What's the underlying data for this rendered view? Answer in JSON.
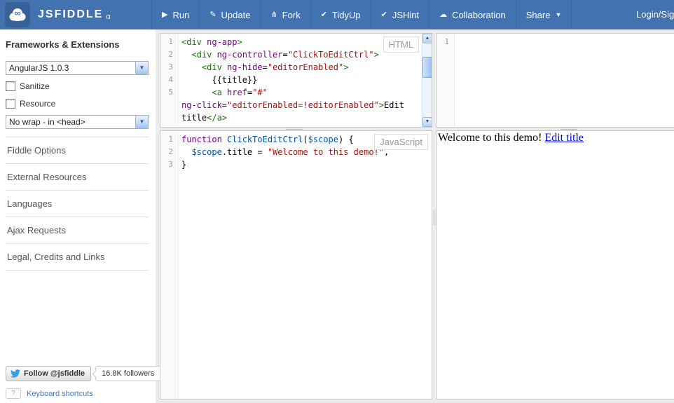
{
  "topbar": {
    "logo_text": "JSFIDDLE",
    "logo_badge": "α",
    "logo_infinity": "∞",
    "menu": [
      {
        "label": "Run",
        "icon": "play-icon",
        "glyph": "▶"
      },
      {
        "label": "Update",
        "icon": "pencil-icon",
        "glyph": "✎"
      },
      {
        "label": "Fork",
        "icon": "fork-icon",
        "glyph": "⋔"
      },
      {
        "label": "TidyUp",
        "icon": "check-icon",
        "glyph": "✔"
      },
      {
        "label": "JSHint",
        "icon": "check-icon",
        "glyph": "✔"
      },
      {
        "label": "Collaboration",
        "icon": "cloud-icon",
        "glyph": "☁"
      },
      {
        "label": "Share",
        "icon": "caret-down-icon",
        "glyph": "",
        "caret": "▼"
      }
    ],
    "login_label": "Login/Sig"
  },
  "sidebar": {
    "frameworks_heading": "Frameworks & Extensions",
    "framework_select_value": "AngularJS 1.0.3",
    "select_arrow": "▼",
    "checkboxes": [
      {
        "label": "Sanitize",
        "checked": false
      },
      {
        "label": "Resource",
        "checked": false
      }
    ],
    "wrap_select_value": "No wrap - in <head>",
    "sections": [
      "Fiddle Options",
      "External Resources",
      "Languages",
      "Ajax Requests",
      "Legal, Credits and Links"
    ],
    "follow_button_label": "Follow @jsfiddle",
    "followers_count": "16.8K followers",
    "shortcut_key": "?",
    "shortcuts_link": "Keyboard shortcuts"
  },
  "editors": {
    "html": {
      "label": "HTML",
      "scroll_up": "▲",
      "scroll_down": "▼",
      "lines": [
        {
          "n": "1",
          "segs": [
            {
              "t": "<div ",
              "c": "tag"
            },
            {
              "t": "ng-app",
              "c": "attr"
            },
            {
              "t": ">",
              "c": "tag"
            }
          ]
        },
        {
          "n": "2",
          "segs": [
            {
              "t": "  "
            },
            {
              "t": "<div ",
              "c": "tag"
            },
            {
              "t": "ng-controller",
              "c": "attr"
            },
            {
              "t": "="
            },
            {
              "t": "\"ClickToEditCtrl\"",
              "c": "str"
            },
            {
              "t": ">",
              "c": "tag"
            }
          ]
        },
        {
          "n": "3",
          "segs": [
            {
              "t": "    "
            },
            {
              "t": "<div ",
              "c": "tag"
            },
            {
              "t": "ng-hide",
              "c": "attr"
            },
            {
              "t": "="
            },
            {
              "t": "\"editorEnabled\"",
              "c": "str"
            },
            {
              "t": ">",
              "c": "tag"
            }
          ]
        },
        {
          "n": "4",
          "segs": [
            {
              "t": "      {{title}}"
            }
          ]
        },
        {
          "n": "5",
          "segs": [
            {
              "t": "      "
            },
            {
              "t": "<a ",
              "c": "tag"
            },
            {
              "t": "href",
              "c": "attr"
            },
            {
              "t": "="
            },
            {
              "t": "\"#\"",
              "c": "str"
            }
          ]
        },
        {
          "n": "",
          "segs": [
            {
              "t": "ng-click",
              "c": "attr"
            },
            {
              "t": "="
            },
            {
              "t": "\"editorEnabled=!editorEnabled\"",
              "c": "str"
            },
            {
              "t": ">",
              "c": "tag"
            },
            {
              "t": "Edit"
            }
          ]
        },
        {
          "n": "",
          "segs": [
            {
              "t": "title"
            },
            {
              "t": "</a>",
              "c": "tag"
            }
          ]
        }
      ]
    },
    "css": {
      "label": "",
      "lines": [
        {
          "n": "1",
          "segs": []
        }
      ]
    },
    "js": {
      "label": "JavaScript",
      "lines": [
        {
          "n": "1",
          "segs": [
            {
              "t": "function ",
              "c": "kw"
            },
            {
              "t": "ClickToEditCtrl",
              "c": "var"
            },
            {
              "t": "("
            },
            {
              "t": "$scope",
              "c": "var"
            },
            {
              "t": ") {"
            }
          ]
        },
        {
          "n": "2",
          "segs": [
            {
              "t": "  "
            },
            {
              "t": "$scope",
              "c": "var"
            },
            {
              "t": ".title = "
            },
            {
              "t": "\"Welcome to this demo!\"",
              "c": "str"
            },
            {
              "t": ","
            }
          ]
        },
        {
          "n": "3",
          "segs": [
            {
              "t": "}"
            }
          ]
        }
      ]
    }
  },
  "result": {
    "text": "Welcome to this demo! ",
    "link_label": "Edit title"
  },
  "colors": {
    "topbar_blue": "#4272b0",
    "syntax_tag": "#117700",
    "syntax_attribute": "#770088",
    "syntax_string": "#aa1111",
    "syntax_keyword": "#770088",
    "syntax_variable": "#0055aa",
    "result_link": "#0000ee",
    "sidebar_link": "#4a77b8"
  }
}
